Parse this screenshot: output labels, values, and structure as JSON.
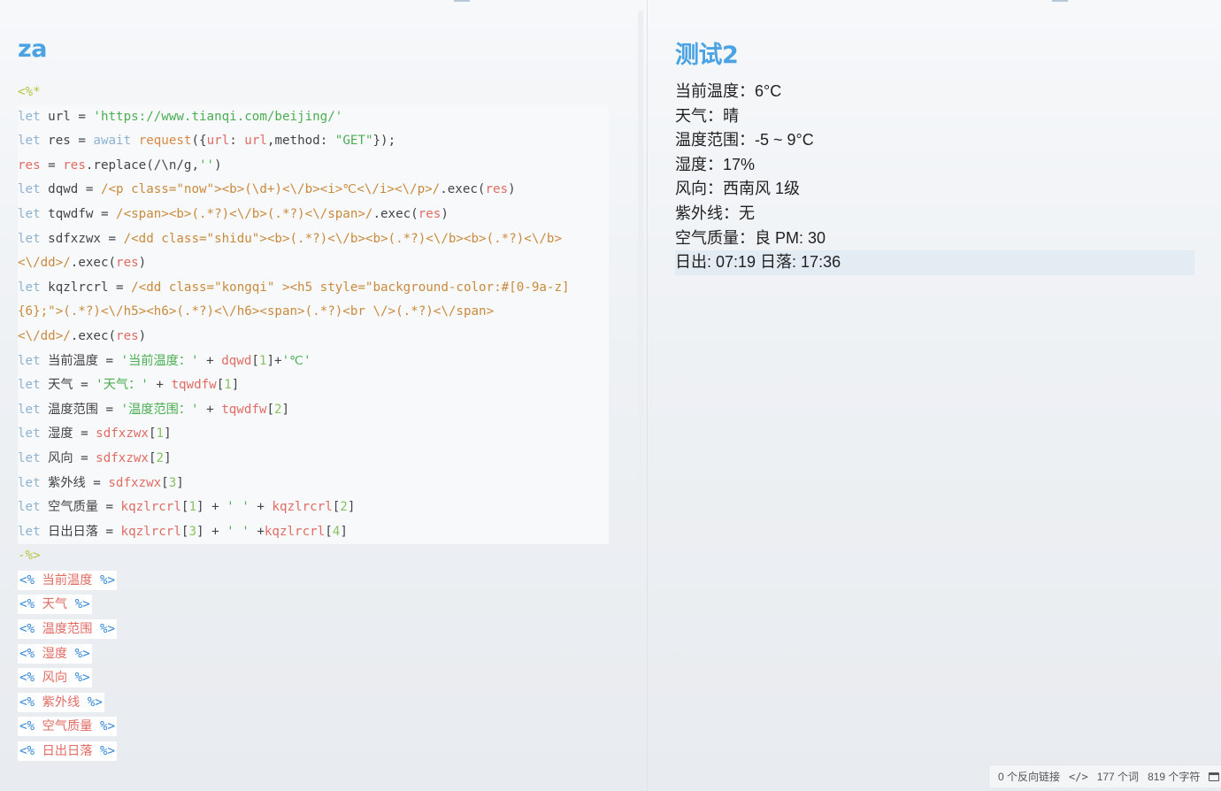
{
  "left_note": {
    "title": "za",
    "code_open": "<%*",
    "code_lines": [
      [
        [
          "kw",
          "let"
        ],
        [
          "op",
          " url = "
        ],
        [
          "str",
          "'https://www.tianqi.com/beijing/'"
        ]
      ],
      [
        [
          "kw",
          "let"
        ],
        [
          "op",
          " res = "
        ],
        [
          "kw",
          "await"
        ],
        [
          "op",
          " "
        ],
        [
          "func",
          "request"
        ],
        [
          "op",
          "({"
        ],
        [
          "var",
          "url"
        ],
        [
          "op",
          ": "
        ],
        [
          "var",
          "url"
        ],
        [
          "op",
          ",method: "
        ],
        [
          "str",
          "\"GET\""
        ],
        [
          "op",
          "});"
        ]
      ],
      [
        [
          "var",
          "res"
        ],
        [
          "op",
          " = "
        ],
        [
          "var",
          "res"
        ],
        [
          "op",
          ".replace(/\\n/g,"
        ],
        [
          "str",
          "''"
        ],
        [
          "op",
          ")"
        ]
      ],
      [
        [
          "kw",
          "let"
        ],
        [
          "op",
          " dqwd = "
        ],
        [
          "reg",
          "/<p class=\"now\"><b>(\\d+)<\\/b><i>℃<\\/i><\\/p>/"
        ],
        [
          "op",
          ".exec("
        ],
        [
          "var",
          "res"
        ],
        [
          "op",
          ")"
        ]
      ],
      [
        [
          "kw",
          "let"
        ],
        [
          "op",
          " tqwdfw = "
        ],
        [
          "reg",
          "/<span><b>(.*?)<\\/b>(.*?)<\\/span>/"
        ],
        [
          "op",
          ".exec("
        ],
        [
          "var",
          "res"
        ],
        [
          "op",
          ")"
        ]
      ],
      [
        [
          "kw",
          "let"
        ],
        [
          "op",
          " sdfxzwx = "
        ],
        [
          "reg",
          "/<dd class=\"shidu\"><b>(.*?)<\\/b><b>(.*?)<\\/b><b>(.*?)<\\/b>"
        ]
      ],
      [
        [
          "reg",
          "<\\/dd>/"
        ],
        [
          "op",
          ".exec("
        ],
        [
          "var",
          "res"
        ],
        [
          "op",
          ")"
        ]
      ],
      [
        [
          "kw",
          "let"
        ],
        [
          "op",
          " kqzlrcrl = "
        ],
        [
          "reg",
          "/<dd class=\"kongqi\" ><h5 style=\"background-color:#[0-9a-z]"
        ]
      ],
      [
        [
          "reg",
          "{6};\">(.*?)<\\/h5><h6>(.*?)<\\/h6><span>(.*?)<br \\/>(.*?)<\\/span>"
        ]
      ],
      [
        [
          "reg",
          "<\\/dd>/"
        ],
        [
          "op",
          ".exec("
        ],
        [
          "var",
          "res"
        ],
        [
          "op",
          ")"
        ]
      ],
      [
        [
          "kw",
          "let"
        ],
        [
          "op",
          " 当前温度 = "
        ],
        [
          "str",
          "'当前温度：'"
        ],
        [
          "op",
          " + "
        ],
        [
          "var",
          "dqwd"
        ],
        [
          "op",
          "["
        ],
        [
          "num",
          "1"
        ],
        [
          "op",
          "]+"
        ],
        [
          "str",
          "'℃'"
        ]
      ],
      [
        [
          "kw",
          "let"
        ],
        [
          "op",
          " 天气 = "
        ],
        [
          "str",
          "'天气：'"
        ],
        [
          "op",
          " + "
        ],
        [
          "var",
          "tqwdfw"
        ],
        [
          "op",
          "["
        ],
        [
          "num",
          "1"
        ],
        [
          "op",
          "]"
        ]
      ],
      [
        [
          "kw",
          "let"
        ],
        [
          "op",
          " 温度范围 = "
        ],
        [
          "str",
          "'温度范围：'"
        ],
        [
          "op",
          " + "
        ],
        [
          "var",
          "tqwdfw"
        ],
        [
          "op",
          "["
        ],
        [
          "num",
          "2"
        ],
        [
          "op",
          "]"
        ]
      ],
      [
        [
          "kw",
          "let"
        ],
        [
          "op",
          " 湿度 = "
        ],
        [
          "var",
          "sdfxzwx"
        ],
        [
          "op",
          "["
        ],
        [
          "num",
          "1"
        ],
        [
          "op",
          "]"
        ]
      ],
      [
        [
          "kw",
          "let"
        ],
        [
          "op",
          " 风向 = "
        ],
        [
          "var",
          "sdfxzwx"
        ],
        [
          "op",
          "["
        ],
        [
          "num",
          "2"
        ],
        [
          "op",
          "]"
        ]
      ],
      [
        [
          "kw",
          "let"
        ],
        [
          "op",
          " 紫外线 = "
        ],
        [
          "var",
          "sdfxzwx"
        ],
        [
          "op",
          "["
        ],
        [
          "num",
          "3"
        ],
        [
          "op",
          "]"
        ]
      ],
      [
        [
          "kw",
          "let"
        ],
        [
          "op",
          " 空气质量 = "
        ],
        [
          "var",
          "kqzlrcrl"
        ],
        [
          "op",
          "["
        ],
        [
          "num",
          "1"
        ],
        [
          "op",
          "] + "
        ],
        [
          "str",
          "' '"
        ],
        [
          "op",
          " + "
        ],
        [
          "var",
          "kqzlrcrl"
        ],
        [
          "op",
          "["
        ],
        [
          "num",
          "2"
        ],
        [
          "op",
          "]"
        ]
      ],
      [
        [
          "kw",
          "let"
        ],
        [
          "op",
          " 日出日落 = "
        ],
        [
          "var",
          "kqzlrcrl"
        ],
        [
          "op",
          "["
        ],
        [
          "num",
          "3"
        ],
        [
          "op",
          "] + "
        ],
        [
          "str",
          "' '"
        ],
        [
          "op",
          " +"
        ],
        [
          "var",
          "kqzlrcrl"
        ],
        [
          "op",
          "["
        ],
        [
          "num",
          "4"
        ],
        [
          "op",
          "]"
        ]
      ]
    ],
    "code_close": "-%>",
    "template_open": "<%",
    "template_close": "%>",
    "template_lines": [
      "当前温度",
      "天气",
      "温度范围",
      "湿度",
      "风向",
      "紫外线",
      "空气质量",
      "日出日落"
    ]
  },
  "right_note": {
    "title": "测试2",
    "lines": [
      "当前温度：6°C",
      "天气：晴",
      "温度范围：-5 ~ 9°C",
      "湿度：17%",
      "风向：西南风 1级",
      "紫外线：无",
      "空气质量：良 PM: 30",
      "日出: 07:19 日落: 17:36"
    ]
  },
  "status_bar": {
    "backlinks": "0 个反向链接",
    "words": "177 个词",
    "chars": "819 个字符"
  }
}
